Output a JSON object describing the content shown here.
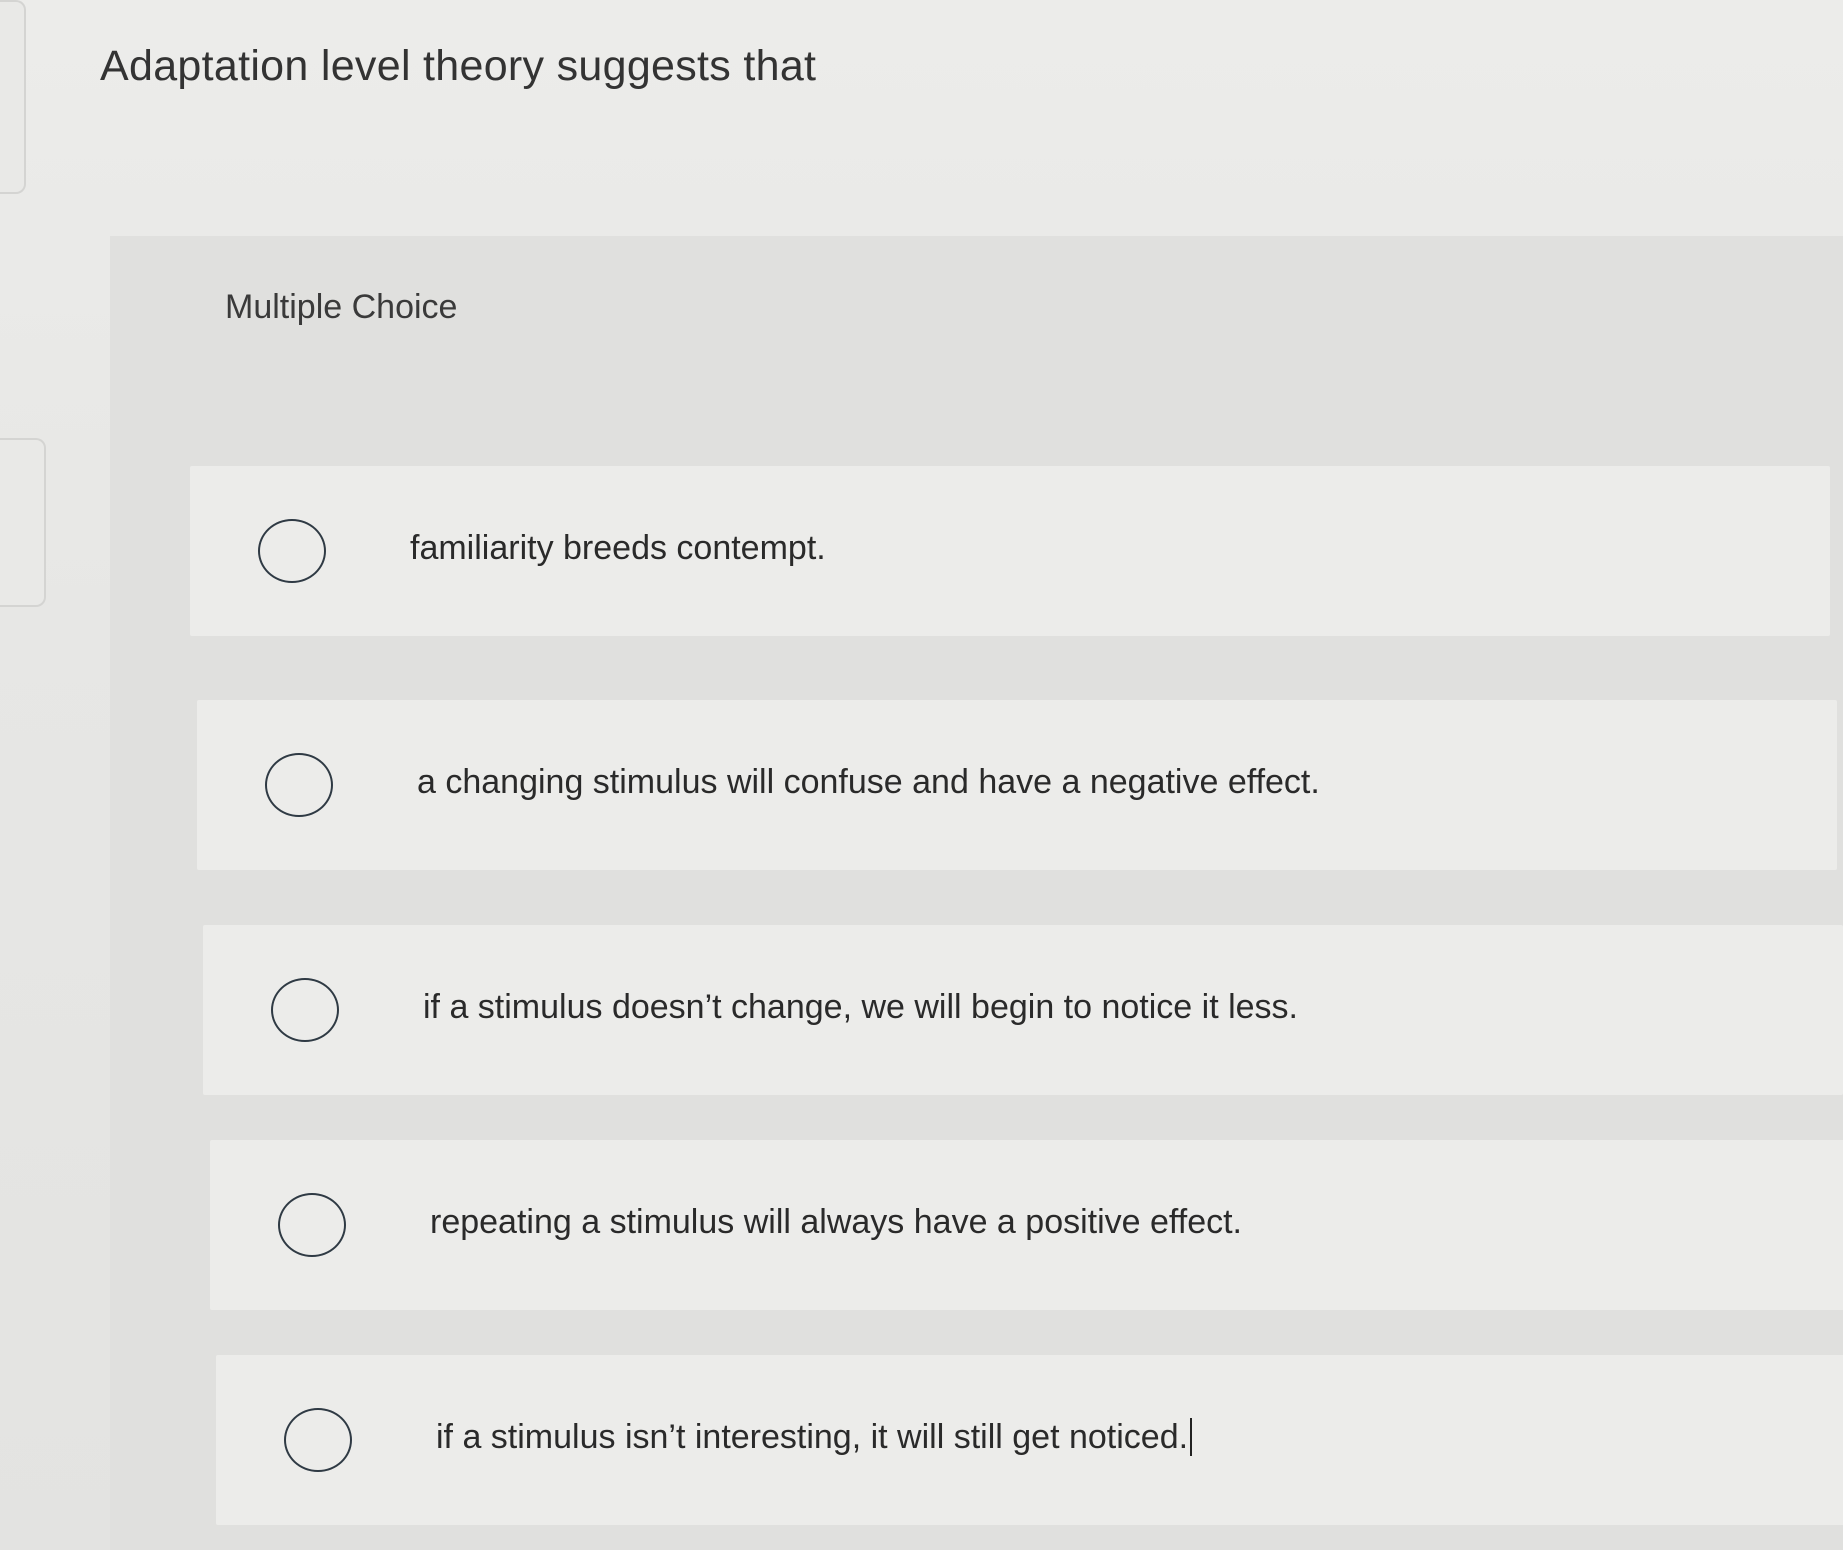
{
  "question": {
    "title": "Adaptation level theory suggests that",
    "type_label": "Multiple Choice"
  },
  "options": [
    {
      "label": "familiarity breeds contempt.",
      "selected": false
    },
    {
      "label": "a changing stimulus will confuse and have a negative effect.",
      "selected": false
    },
    {
      "label": "if a stimulus doesn’t change, we will begin to notice it less.",
      "selected": false
    },
    {
      "label": "repeating a stimulus will always have a positive effect.",
      "selected": false
    },
    {
      "label": "if a stimulus isn’t interesting, it will still get noticed.",
      "selected": false
    }
  ]
}
